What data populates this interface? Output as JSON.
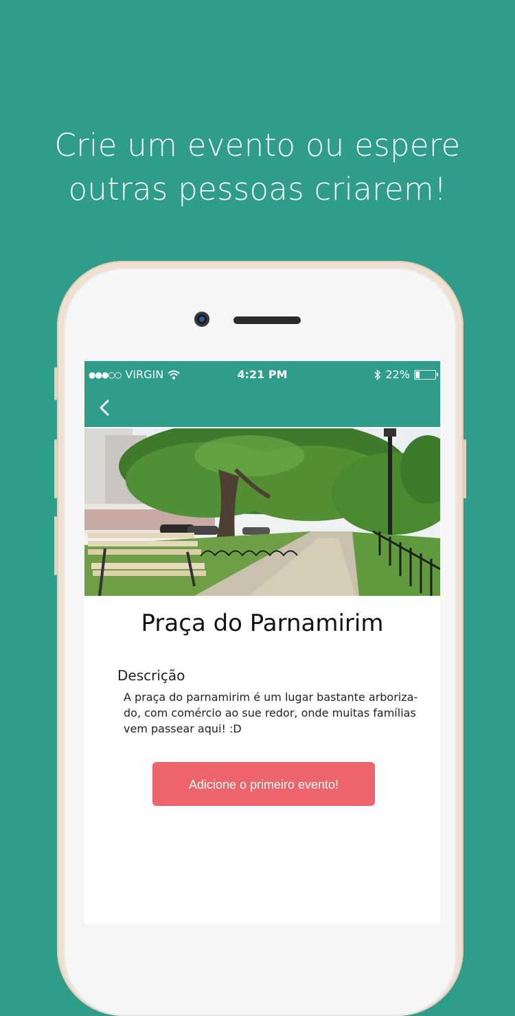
{
  "headline": {
    "line1": "Crie um evento ou espere",
    "line2": "outras pessoas criarem!"
  },
  "status_bar": {
    "signal": "●●●○○",
    "carrier": "VIRGIN",
    "time": "4:21 PM",
    "battery": "22%",
    "battery_level": 0.22
  },
  "nav": {
    "back_icon": "chevron-left-icon"
  },
  "place": {
    "name": "Praça do Parnamirim",
    "description_label": "Descrição",
    "description": "A praça do parnamirim é um lugar bastante arboriza-do, com comércio ao sue redor, onde muitas famílias vem passear aqui! :D"
  },
  "actions": {
    "add_event_label": "Adicione o primeiro evento!"
  },
  "colors": {
    "background": "#2e9e8b",
    "accent": "#ef646a",
    "phone_frame": "#efe0cf"
  }
}
